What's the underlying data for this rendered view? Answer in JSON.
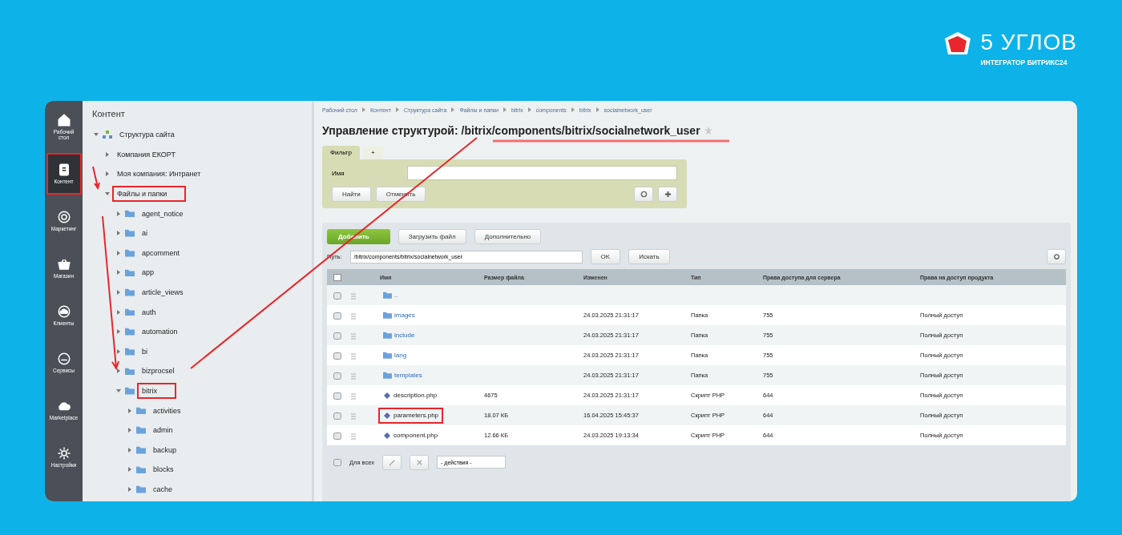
{
  "brand": {
    "name": "5 УГЛОВ",
    "tagline": "ИНТЕГРАТОР БИТРИКС24"
  },
  "sidebar": {
    "items": [
      {
        "label": "Рабочий стол",
        "selected": false,
        "highlighted": false
      },
      {
        "label": "Контент",
        "selected": true,
        "highlighted": true
      },
      {
        "label": "Маркетинг",
        "selected": false,
        "highlighted": false
      },
      {
        "label": "Магазин",
        "selected": false,
        "highlighted": false
      },
      {
        "label": "Клиенты",
        "selected": false,
        "highlighted": false
      },
      {
        "label": "Сервисы",
        "selected": false,
        "highlighted": false
      },
      {
        "label": "Marketplace",
        "selected": false,
        "highlighted": false
      },
      {
        "label": "Настройки",
        "selected": false,
        "highlighted": false
      }
    ]
  },
  "tree": {
    "title": "Контент",
    "items": [
      {
        "label": "Структура сайта",
        "kind": "site",
        "expanded": true,
        "highlighted": false,
        "children": [
          {
            "label": "Компания ЕКОРТ",
            "expanded": false,
            "highlighted": false
          },
          {
            "label": "Моя компания: Интранет",
            "expanded": false,
            "highlighted": false
          },
          {
            "label": "Файлы и папки",
            "expanded": true,
            "highlighted": true,
            "children": [
              {
                "label": "agent_notice",
                "kind": "folder",
                "expanded": false,
                "highlighted": false
              },
              {
                "label": "ai",
                "kind": "folder",
                "expanded": false,
                "highlighted": false
              },
              {
                "label": "apcomment",
                "kind": "folder",
                "expanded": false,
                "highlighted": false
              },
              {
                "label": "app",
                "kind": "folder",
                "expanded": false,
                "highlighted": false
              },
              {
                "label": "article_views",
                "kind": "folder",
                "expanded": false,
                "highlighted": false
              },
              {
                "label": "auth",
                "kind": "folder",
                "expanded": false,
                "highlighted": false
              },
              {
                "label": "automation",
                "kind": "folder",
                "expanded": false,
                "highlighted": false
              },
              {
                "label": "bi",
                "kind": "folder",
                "expanded": false,
                "highlighted": false
              },
              {
                "label": "bizprocsel",
                "kind": "folder",
                "expanded": false,
                "highlighted": false
              },
              {
                "label": "bitrix",
                "kind": "folder",
                "expanded": true,
                "highlighted": true,
                "children": [
                  {
                    "label": "activities",
                    "kind": "folder",
                    "expanded": false,
                    "highlighted": false
                  },
                  {
                    "label": "admin",
                    "kind": "folder",
                    "expanded": false,
                    "highlighted": false
                  },
                  {
                    "label": "backup",
                    "kind": "folder",
                    "expanded": false,
                    "highlighted": false
                  },
                  {
                    "label": "blocks",
                    "kind": "folder",
                    "expanded": false,
                    "highlighted": false
                  },
                  {
                    "label": "cache",
                    "kind": "folder",
                    "expanded": false,
                    "highlighted": false
                  }
                ]
              }
            ]
          }
        ]
      }
    ]
  },
  "breadcrumbs": [
    "Рабочий стол",
    "Контент",
    "Структура сайта",
    "Файлы и папки",
    "bitrix",
    "components",
    "bitrix",
    "socialnetwork_user"
  ],
  "title": {
    "prefix": "Управление структурой:",
    "path": "/bitrix/components/bitrix/socialnetwork_user"
  },
  "filter": {
    "tabs": [
      {
        "label": "Фильтр",
        "selected": true
      },
      {
        "label": "+",
        "selected": false
      }
    ],
    "field_label": "Имя",
    "buttons": [
      "Найти",
      "Отменить"
    ]
  },
  "toolbar": {
    "add": "Добавить",
    "upload": "Загрузить файл",
    "more": "Дополнительно"
  },
  "path_bar": {
    "label": "Путь:",
    "value": "/bitrix/components/bitrix/socialnetwork_user",
    "buttons": [
      "OK",
      "Искать"
    ]
  },
  "table": {
    "columns": [
      "Имя",
      "Размер файла",
      "Изменен",
      "Тип",
      "Права доступа для сервера",
      "Права на доступ продукта"
    ],
    "select_all_checked": false,
    "rows": [
      {
        "kind": "folder",
        "name": "..",
        "size": "",
        "modified": "",
        "type": "",
        "perm": "",
        "access": "",
        "highlighted": false
      },
      {
        "kind": "folder",
        "name": "images",
        "size": "",
        "modified": "24.03.2025 21:31:17",
        "type": "Папка",
        "perm": "755",
        "access": "Полный доступ",
        "highlighted": false
      },
      {
        "kind": "folder",
        "name": "include",
        "size": "",
        "modified": "24.03.2025 21:31:17",
        "type": "Папка",
        "perm": "755",
        "access": "Полный доступ",
        "highlighted": false
      },
      {
        "kind": "folder",
        "name": "lang",
        "size": "",
        "modified": "24.03.2025 21:31:17",
        "type": "Папка",
        "perm": "755",
        "access": "Полный доступ",
        "highlighted": false
      },
      {
        "kind": "folder",
        "name": "templates",
        "size": "",
        "modified": "24.03.2025 21:31:17",
        "type": "Папка",
        "perm": "755",
        "access": "Полный доступ",
        "highlighted": false
      },
      {
        "kind": "php",
        "name": "description.php",
        "size": "4675",
        "modified": "24.03.2025 21:31:17",
        "type": "Скрипт PHP",
        "perm": "644",
        "access": "Полный доступ",
        "highlighted": false
      },
      {
        "kind": "php",
        "name": "parameters.php",
        "size": "18.07 КБ",
        "modified": "16.04.2025 15:45:37",
        "type": "Скрипт PHP",
        "perm": "644",
        "access": "Полный доступ",
        "highlighted": true
      },
      {
        "kind": "php",
        "name": "component.php",
        "size": "12.66 КБ",
        "modified": "24.03.2025 19:13:34",
        "type": "Скрипт PHP",
        "perm": "644",
        "access": "Полный доступ",
        "highlighted": false
      }
    ],
    "footer": {
      "check_label": "Для всех",
      "action_select": "- действия -"
    }
  }
}
